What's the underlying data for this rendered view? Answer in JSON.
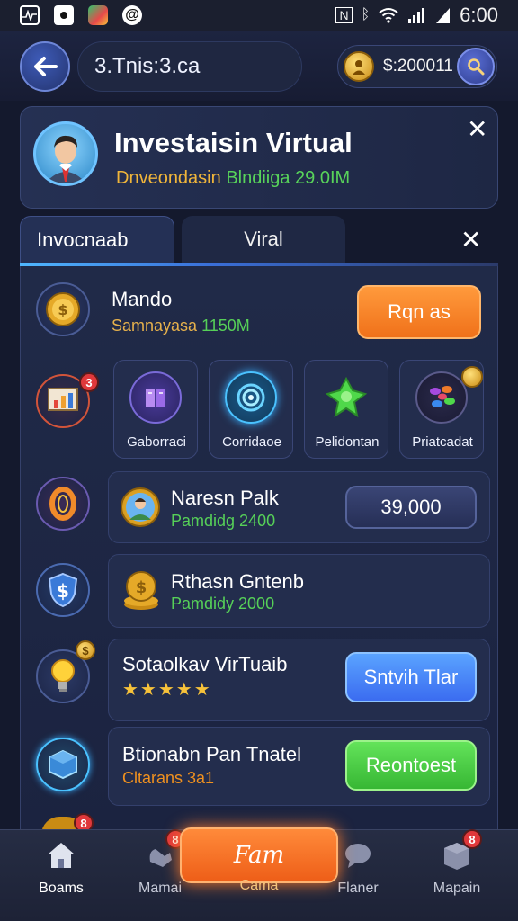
{
  "status_bar": {
    "time": "6:00"
  },
  "topbar": {
    "title": "3.Tnis:3.ca",
    "balance": "$:200011"
  },
  "header": {
    "title": "Investaisin Virtual",
    "subtitle_prefix": "Dnveondasin",
    "subtitle_green": "Blndiiga 29.0IM"
  },
  "tabs": [
    {
      "label": "Invocnaab",
      "active": true
    },
    {
      "label": "Viral",
      "active": false
    }
  ],
  "rows": {
    "mando": {
      "title": "Mando",
      "sub_prefix": "Samnayasa",
      "sub_value": "1150M",
      "button": "Rqn as"
    },
    "categories": [
      {
        "label": "Gaborraci"
      },
      {
        "label": "Corridaoe"
      },
      {
        "label": "Pelidontan"
      },
      {
        "label": "Priatcadat"
      }
    ],
    "naresn": {
      "title": "Naresn Palk",
      "sub": "Pamdidg 2400",
      "button": "39,000"
    },
    "rthasn": {
      "title": "Rthasn Gntenb",
      "sub": "Pamdidy 2000"
    },
    "sotaolkav": {
      "title": "Sotaolkav VirTuaib",
      "stars": "★★★★★",
      "button": "Sntvih Tlar"
    },
    "btionabn": {
      "title": "Btionabn Pan Tnatel",
      "sub": "Cltarans 3a1",
      "button": "Reontoest"
    }
  },
  "badges": {
    "row_chart": "3",
    "row_bulb": "$",
    "nav_mamai": "8",
    "nav_mapain": "8",
    "row_partial": "8"
  },
  "bottom_nav": {
    "items": [
      {
        "label": "Boams"
      },
      {
        "label": "Mamai"
      },
      {
        "label": "Flaner"
      },
      {
        "label": "Mapain"
      }
    ],
    "center_button": "Fam",
    "center_label": "Cama"
  },
  "colors": {
    "accent_orange": "#f0711a",
    "accent_blue": "#3b6cf0",
    "accent_green": "#37b734",
    "gold_text": "#e6b14c",
    "green_text": "#56d058"
  }
}
